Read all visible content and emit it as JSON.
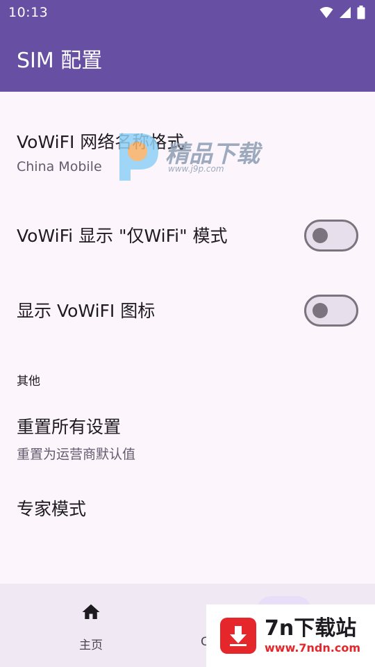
{
  "status_bar": {
    "time": "10:13",
    "icons": [
      "wifi-icon",
      "signal-icon",
      "battery-icon"
    ]
  },
  "app_bar": {
    "title": "SIM 配置",
    "color": "#6750a4"
  },
  "preferences": [
    {
      "title": "VoWiFI 网络名称格式",
      "summary": "China Mobile"
    },
    {
      "title": "VoWiFi 显示 \"仅WiFi\" 模式",
      "switch_on": false
    },
    {
      "title": "显示 VoWiFI 图标",
      "switch_on": false
    }
  ],
  "other_section": {
    "header": "其他",
    "items": [
      {
        "title": "重置所有设置",
        "summary": "重置为运营商默认值"
      },
      {
        "title": "专家模式"
      }
    ]
  },
  "bottom_nav": {
    "items": [
      {
        "label": "主页",
        "icon": "home-icon"
      },
      {
        "label": "C",
        "icon": "settings-icon",
        "selected": true
      }
    ]
  },
  "watermarks": {
    "top_text": "精品下载",
    "top_url": "www.j9p.com",
    "badge_name": "7n下载站",
    "badge_url": "www.7ndn.com"
  }
}
